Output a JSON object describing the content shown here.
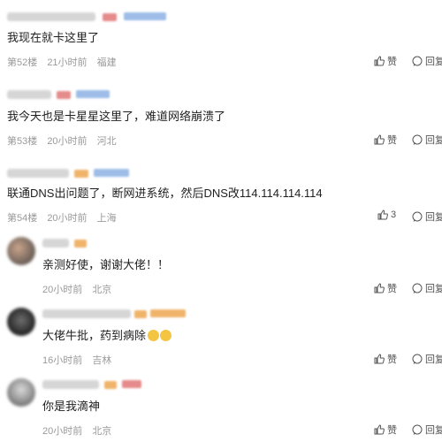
{
  "actions": {
    "like": "赞",
    "reply": "回复"
  },
  "top_posts": [
    {
      "content": "我现在就卡这里了",
      "floor": "第52楼",
      "time": "21小时前",
      "location": "福建",
      "like": "赞"
    },
    {
      "content": "我今天也是卡星星这里了，难道网络崩溃了",
      "floor": "第53楼",
      "time": "20小时前",
      "location": "河北",
      "like": "赞"
    },
    {
      "content": "联通DNS出问题了，断网进系统，然后DNS改114.114.114.114",
      "floor": "第54楼",
      "time": "20小时前",
      "location": "上海",
      "like": "3"
    }
  ],
  "replies": [
    {
      "content": "亲测好使，谢谢大佬！！",
      "time": "20小时前",
      "location": "北京",
      "like": "赞"
    },
    {
      "content": "大佬牛批，药到病除",
      "time": "16小时前",
      "location": "吉林",
      "like": "赞"
    },
    {
      "content": "你是我滴神",
      "time": "20小时前",
      "location": "北京",
      "like": "赞"
    }
  ],
  "colors": {
    "text": "#1f1f1f",
    "meta": "#9a9a9a",
    "bg": "#ffffff"
  }
}
